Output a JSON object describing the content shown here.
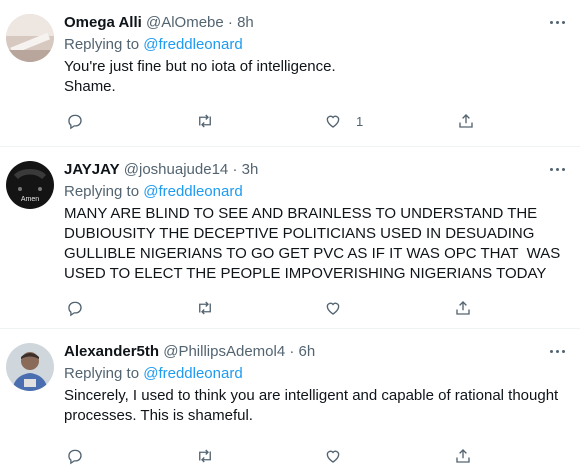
{
  "tweets": [
    {
      "name": "Omega Alli",
      "handle": "@AlOmebe",
      "separator": "·",
      "time": "8h",
      "replying_prefix": "Replying to ",
      "replying_to": "@freddleonard",
      "lines": [
        "You're just fine but no iota of intelligence.",
        "Shame."
      ],
      "like_count": "1"
    },
    {
      "name": "JAYJAY",
      "handle": "@joshuajude14",
      "separator": "·",
      "time": "3h",
      "avatar_text": "Amen",
      "replying_prefix": "Replying to ",
      "replying_to": "@freddleonard",
      "lines": [
        "MANY ARE BLIND TO SEE AND BRAINLESS TO UNDERSTAND THE",
        "DUBIOUSITY THE DECEPTIVE POLITICIANS USED IN DESUADING",
        "GULLIBLE NIGERIANS TO GO GET PVC AS IF IT WAS OPC THAT  WAS",
        "USED TO ELECT THE PEOPLE IMPOVERISHING NIGERIANS TODAY"
      ]
    },
    {
      "name": "Alexander5th",
      "handle": "@PhillipsAdemol4",
      "separator": "·",
      "time": "6h",
      "replying_prefix": "Replying to ",
      "replying_to": "@freddleonard",
      "lines": [
        "Sincerely, I used to think you are intelligent and capable of rational thought",
        "processes. This is shameful."
      ]
    }
  ],
  "icons": {
    "reply": "reply-icon",
    "retweet": "retweet-icon",
    "like": "like-icon",
    "share": "share-icon",
    "more": "more-icon"
  },
  "colors": {
    "link": "#1d9bf0",
    "secondary_text": "#536471",
    "divider": "#eff3f4"
  }
}
